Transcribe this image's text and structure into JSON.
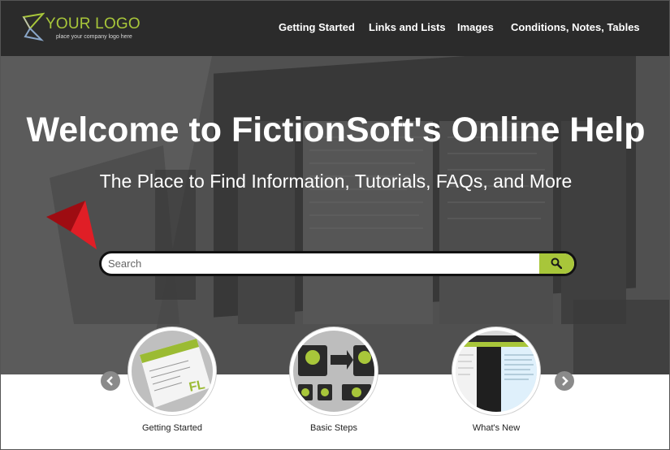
{
  "logo": {
    "name": "YOUR LOGO",
    "tagline": "place your company logo here"
  },
  "nav": [
    {
      "label": "Getting Started"
    },
    {
      "label": "Links and Lists"
    },
    {
      "label": "Images"
    },
    {
      "label": "Conditions, Notes, Tables"
    }
  ],
  "hero": {
    "title": "Welcome to FictionSoft's Online Help",
    "subtitle": "The Place to Find Information, Tutorials, FAQs, and More"
  },
  "search": {
    "placeholder": "Search",
    "value": "",
    "button_icon": "search-icon"
  },
  "carousel": {
    "prev_icon": "chevron-left-icon",
    "next_icon": "chevron-right-icon",
    "items": [
      {
        "label": "Getting Started"
      },
      {
        "label": "Basic Steps"
      },
      {
        "label": "What's New"
      }
    ]
  },
  "colors": {
    "accent": "#a8c63a",
    "header_bg": "#2b2b2b",
    "arrow_red": "#d4121a"
  }
}
